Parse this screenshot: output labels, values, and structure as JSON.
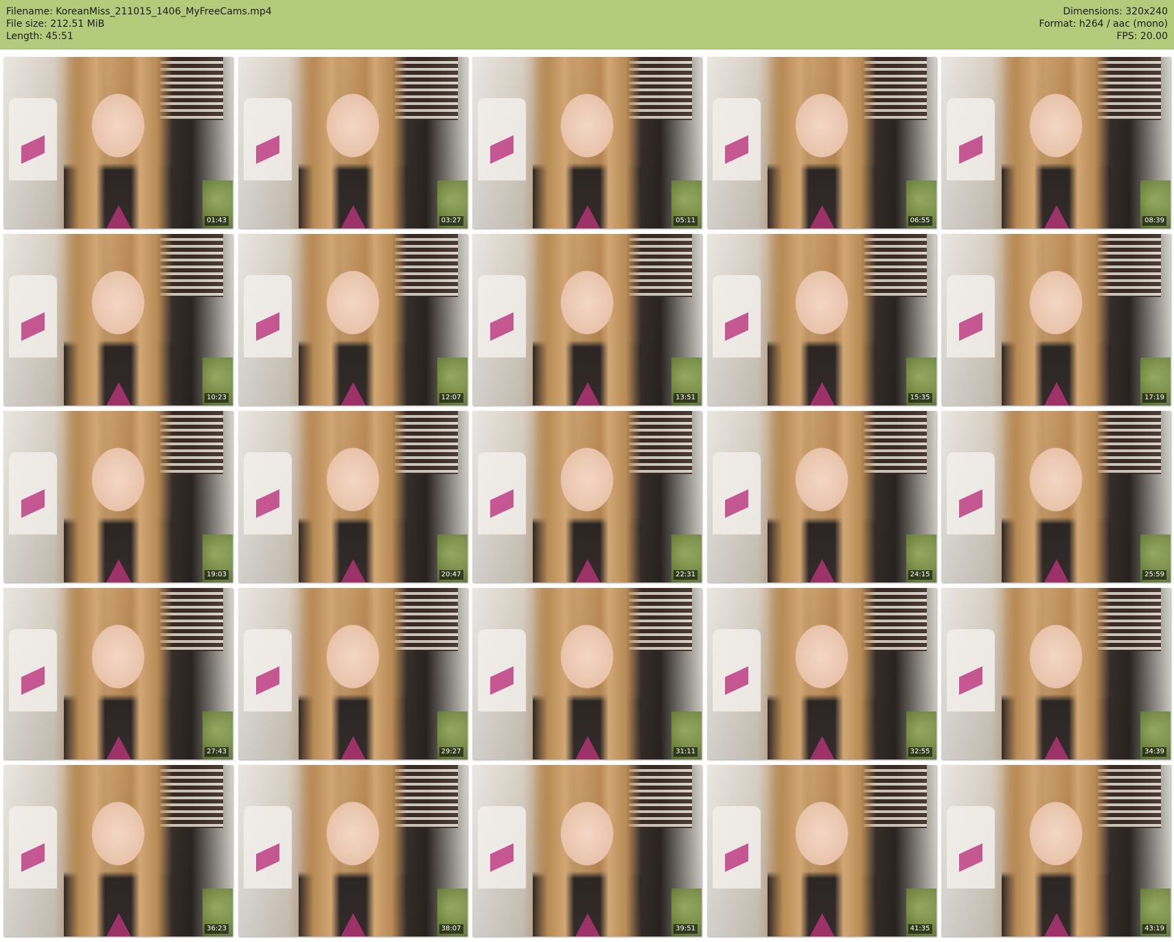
{
  "info": {
    "filename_line": "Filename: KoreanMiss_211015_1406_MyFreeCams.mp4",
    "filesize_line": "File size: 212.51 MiB",
    "length_line": "Length: 45:51",
    "dimensions_line": "Dimensions: 320x240",
    "format_line": "Format: h264 / aac (mono)",
    "fps_line": "FPS: 20.00"
  },
  "colors": {
    "header_bg": "#b2cc7c",
    "page_bg": "#ffffff",
    "timestamp_bg": "#000000"
  },
  "thumbnails": [
    {
      "time": "01:43"
    },
    {
      "time": "03:27"
    },
    {
      "time": "05:11"
    },
    {
      "time": "06:55"
    },
    {
      "time": "08:39"
    },
    {
      "time": "10:23"
    },
    {
      "time": "12:07"
    },
    {
      "time": "13:51"
    },
    {
      "time": "15:35"
    },
    {
      "time": "17:19"
    },
    {
      "time": "19:03"
    },
    {
      "time": "20:47"
    },
    {
      "time": "22:31"
    },
    {
      "time": "24:15"
    },
    {
      "time": "25:59"
    },
    {
      "time": "27:43"
    },
    {
      "time": "29:27"
    },
    {
      "time": "31:11"
    },
    {
      "time": "32:55"
    },
    {
      "time": "34:39"
    },
    {
      "time": "36:23"
    },
    {
      "time": "38:07"
    },
    {
      "time": "39:51"
    },
    {
      "time": "41:35"
    },
    {
      "time": "43:19"
    }
  ]
}
